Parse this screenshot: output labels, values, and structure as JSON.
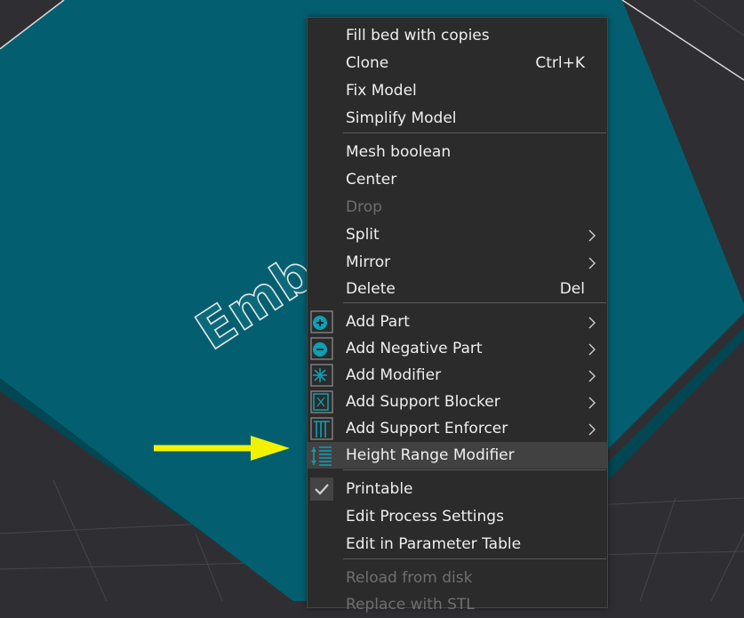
{
  "viewport": {
    "model_text": "Emb"
  },
  "menu": {
    "items": [
      {
        "label": "Fill bed with copies",
        "shortcut": "",
        "submenu": false,
        "disabled": false,
        "icon": ""
      },
      {
        "label": "Clone",
        "shortcut": "Ctrl+K",
        "submenu": false,
        "disabled": false,
        "icon": ""
      },
      {
        "label": "Fix Model",
        "shortcut": "",
        "submenu": false,
        "disabled": false,
        "icon": ""
      },
      {
        "label": "Simplify Model",
        "shortcut": "",
        "submenu": false,
        "disabled": false,
        "icon": ""
      },
      {
        "label": "Mesh boolean",
        "shortcut": "",
        "submenu": false,
        "disabled": false,
        "icon": ""
      },
      {
        "label": "Center",
        "shortcut": "",
        "submenu": false,
        "disabled": false,
        "icon": ""
      },
      {
        "label": "Drop",
        "shortcut": "",
        "submenu": false,
        "disabled": true,
        "icon": ""
      },
      {
        "label": "Split",
        "shortcut": "",
        "submenu": true,
        "disabled": false,
        "icon": ""
      },
      {
        "label": "Mirror",
        "shortcut": "",
        "submenu": true,
        "disabled": false,
        "icon": ""
      },
      {
        "label": "Delete",
        "shortcut": "Del",
        "submenu": false,
        "disabled": false,
        "icon": ""
      },
      {
        "label": "Add Part",
        "shortcut": "",
        "submenu": true,
        "disabled": false,
        "icon": "add-part-icon"
      },
      {
        "label": "Add Negative Part",
        "shortcut": "",
        "submenu": true,
        "disabled": false,
        "icon": "add-negative-part-icon"
      },
      {
        "label": "Add Modifier",
        "shortcut": "",
        "submenu": true,
        "disabled": false,
        "icon": "add-modifier-icon"
      },
      {
        "label": "Add Support Blocker",
        "shortcut": "",
        "submenu": true,
        "disabled": false,
        "icon": "support-blocker-icon"
      },
      {
        "label": "Add Support Enforcer",
        "shortcut": "",
        "submenu": true,
        "disabled": false,
        "icon": "support-enforcer-icon"
      },
      {
        "label": "Height Range Modifier",
        "shortcut": "",
        "submenu": false,
        "disabled": false,
        "icon": "height-range-icon",
        "highlighted": true
      },
      {
        "label": "Printable",
        "shortcut": "",
        "submenu": false,
        "disabled": false,
        "icon": "check-icon",
        "checked": true
      },
      {
        "label": "Edit Process Settings",
        "shortcut": "",
        "submenu": false,
        "disabled": false,
        "icon": ""
      },
      {
        "label": "Edit in Parameter Table",
        "shortcut": "",
        "submenu": false,
        "disabled": false,
        "icon": ""
      },
      {
        "label": "Reload from disk",
        "shortcut": "",
        "submenu": false,
        "disabled": true,
        "icon": ""
      },
      {
        "label": "Replace with STL",
        "shortcut": "",
        "submenu": false,
        "disabled": true,
        "icon": ""
      }
    ]
  },
  "colors": {
    "plate": "#035f70",
    "plate_edge": "#014653",
    "menu_bg": "#2b2b2b",
    "accent_icon": "#0ea0b5",
    "arrow": "#f2f200"
  }
}
